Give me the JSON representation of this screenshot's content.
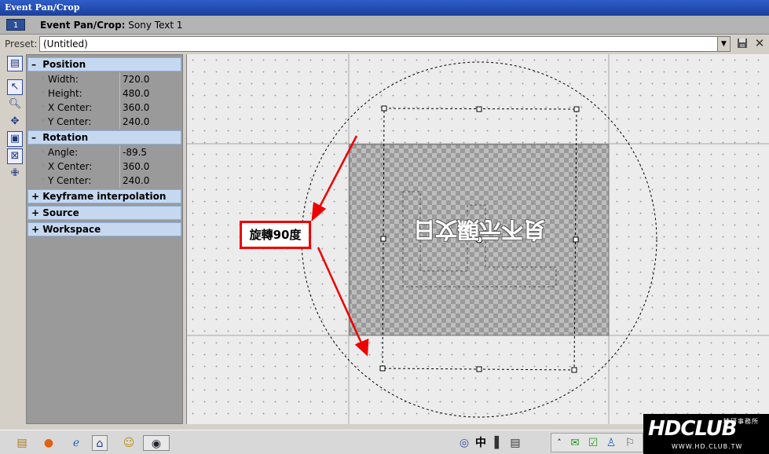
{
  "window": {
    "title": "Event Pan/Crop"
  },
  "header": {
    "number": "1",
    "label": "Event Pan/Crop:",
    "clip": "Sony Text 1"
  },
  "preset": {
    "label": "Preset:",
    "value": "(Untitled)"
  },
  "sections": {
    "position": {
      "title": "Position",
      "sign": "–"
    },
    "rotation": {
      "title": "Rotation",
      "sign": "–"
    },
    "keyframe": {
      "title": "Keyframe interpolation",
      "sign": "+"
    },
    "source": {
      "title": "Source",
      "sign": "+"
    },
    "workspace": {
      "title": "Workspace",
      "sign": "+"
    }
  },
  "position": [
    {
      "key": "Width:",
      "value": "720.0"
    },
    {
      "key": "Height:",
      "value": "480.0"
    },
    {
      "key": "X Center:",
      "value": "360.0"
    },
    {
      "key": "Y Center:",
      "value": "240.0"
    }
  ],
  "rotation": [
    {
      "key": "Angle:",
      "value": "-89.5"
    },
    {
      "key": "X Center:",
      "value": "360.0"
    },
    {
      "key": "Y Center:",
      "value": "240.0"
    }
  ],
  "canvas": {
    "overlay_text": "日文顯示不良",
    "callout": "旋轉90度"
  },
  "taskbar": {
    "ime_char": "中"
  },
  "logo": {
    "brand": "HDCLUB",
    "chinese": "精研事務所",
    "url": "WWW.HD.CLUB.TW"
  },
  "icons": {
    "toolbar": [
      "properties-icon",
      "arrow-pointer-icon",
      "magnifier-icon",
      "zoom-edit-icon",
      "normal-edit-icon",
      "crop-fit-icon",
      "move-icon"
    ],
    "preset": [
      "save-icon",
      "close-icon"
    ]
  },
  "colors": {
    "callout_border": "#e00000",
    "titlebar": "#2e5ec8",
    "section_header": "#c6d8f0"
  }
}
